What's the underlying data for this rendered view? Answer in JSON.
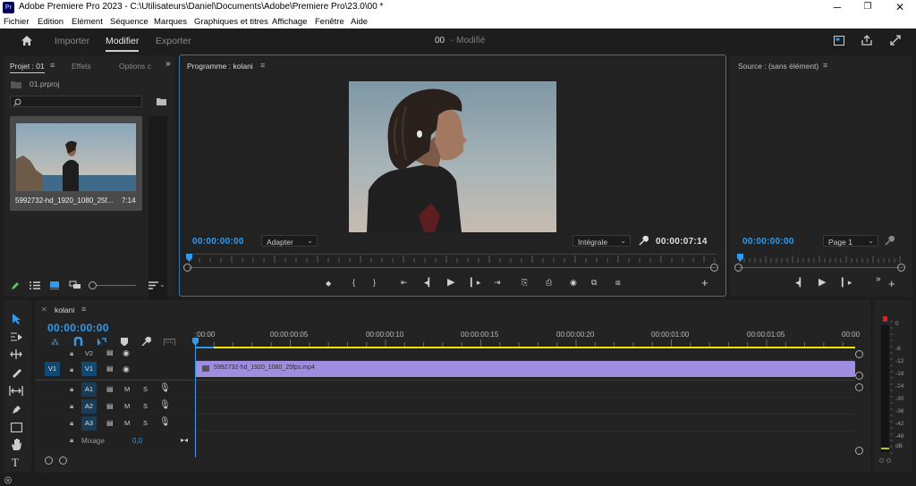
{
  "window": {
    "title": "Adobe Premiere Pro 2023 - C:\\Utilisateurs\\Daniel\\Documents\\Adobe\\Premiere Pro\\23.0\\00 *",
    "app_icon": "Pr",
    "minimize": "─",
    "maximize": "❐",
    "close": "✕"
  },
  "menu": [
    "Fichier",
    "Edition",
    "Elément",
    "Séquence",
    "Marques",
    "Graphiques et titres",
    "Affichage",
    "Fenêtre",
    "Aide"
  ],
  "workspace": {
    "tabs": [
      "Importer",
      "Modifier",
      "Exporter"
    ],
    "active": "Modifier",
    "project_status": "00",
    "modified_label": "- Modifié"
  },
  "project_panel": {
    "tabs": [
      "Projet : 01",
      "Effets",
      "Options c"
    ],
    "file_name": "01.prproj",
    "search_placeholder": "",
    "clip": {
      "name": "5992732-hd_1920_1080_25f...",
      "duration": "7:14"
    }
  },
  "program_monitor": {
    "title": "Programme : kolani",
    "timecode_in": "00:00:00:00",
    "fit": "Adapter",
    "quality": "Intégrale",
    "duration": "00:00:07:14",
    "transport": [
      "⬥",
      "{",
      "}",
      "⇤",
      "◂▎",
      "▶",
      "▎▸",
      "⇥",
      "⎘",
      "⎙",
      "◉",
      "⧉",
      "⧈"
    ],
    "add": "+"
  },
  "source_monitor": {
    "title": "Source : (sans élément)",
    "timecode": "00:00:00:00",
    "page": "Page 1",
    "add": "+"
  },
  "timeline": {
    "sequence": "kolani",
    "timecode": "00:00:00:00",
    "ruler": [
      ":00:00",
      "00:00:00:05",
      "00:00:00:10",
      "00:00:00:15",
      "00:00:00:20",
      "00:00:01:00",
      "00:00:01:05",
      "00:00"
    ],
    "video_tracks": [
      {
        "src": "",
        "name": "V2"
      },
      {
        "src": "V1",
        "name": "V1"
      }
    ],
    "audio_tracks": [
      {
        "src": "",
        "name": "A1"
      },
      {
        "src": "",
        "name": "A2"
      },
      {
        "src": "",
        "name": "A3"
      }
    ],
    "mix": {
      "label": "Mixage",
      "value": "0,0"
    },
    "clip": {
      "name": "5992732-hd_1920_1080_25fps.mp4",
      "color": "#9f8ee0"
    },
    "mute": "M",
    "solo": "S"
  },
  "audio_meter": {
    "scale": [
      "0",
      "-6",
      "-12",
      "-18",
      "-24",
      "-30",
      "-36",
      "-42",
      "-48",
      "dB"
    ]
  },
  "colors": {
    "accent": "#2e9bf0",
    "clip": "#9f8ee0",
    "workarea": "#f5e300"
  }
}
